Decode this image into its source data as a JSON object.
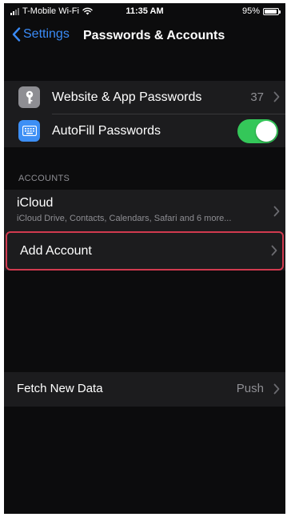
{
  "status_bar": {
    "carrier": "T-Mobile Wi-Fi",
    "time": "11:35 AM",
    "battery_percent_text": "95%",
    "battery_level": 0.95
  },
  "nav": {
    "back_label": "Settings",
    "title": "Passwords & Accounts"
  },
  "passwords_group": {
    "website_passwords": {
      "label": "Website & App Passwords",
      "value": "37",
      "icon": "key-icon"
    },
    "autofill": {
      "label": "AutoFill Passwords",
      "enabled": true,
      "icon": "keyboard-icon"
    }
  },
  "accounts_section": {
    "header": "ACCOUNTS",
    "icloud": {
      "title": "iCloud",
      "subtitle": "iCloud Drive, Contacts, Calendars, Safari and 6 more..."
    },
    "add_account": {
      "label": "Add Account"
    }
  },
  "fetch_group": {
    "label": "Fetch New Data",
    "value": "Push"
  },
  "colors": {
    "background": "#0c0c0d",
    "cell": "#1c1c1e",
    "accent_blue": "#3a8bf7",
    "toggle_green": "#34c759",
    "highlight_red": "#d13a4f",
    "secondary_text": "#8e8e93"
  }
}
